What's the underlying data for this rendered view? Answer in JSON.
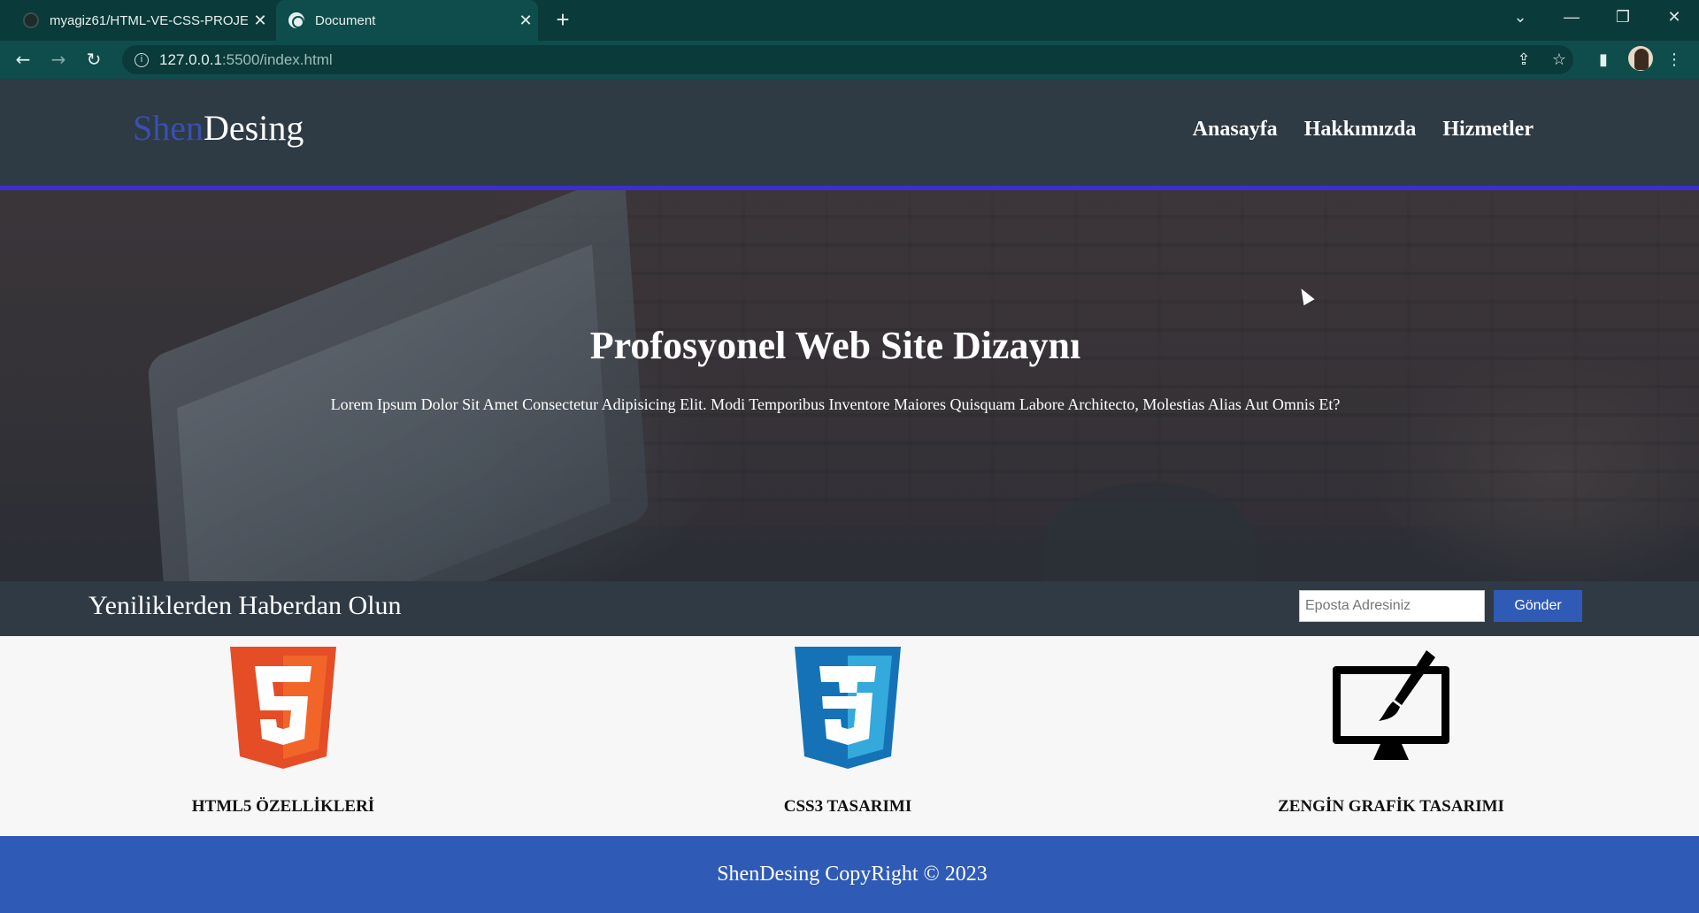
{
  "browser": {
    "tabs": [
      {
        "title": "myagiz61/HTML-VE-CSS-PROJE-",
        "close": "✕",
        "favicon": "github-icon"
      },
      {
        "title": "Document",
        "close": "✕",
        "favicon": "globe-icon"
      }
    ],
    "new_tab": "+",
    "window_controls": {
      "dropdown": "⌄",
      "minimize": "—",
      "restore": "❐",
      "close": "✕"
    },
    "nav": {
      "back": "←",
      "forward": "→",
      "reload": "↻"
    },
    "url": {
      "host": "127.0.0.1",
      "rest": ":5500/index.html",
      "info": "i"
    },
    "toolbar_icons": {
      "share": "⇪",
      "bookmark": "☆",
      "sidebar": "▮",
      "menu": "⋮"
    }
  },
  "site": {
    "logo": {
      "part1": "Shen",
      "part2": "Desing"
    },
    "menu": [
      "Anasayfa",
      "Hakkımızda",
      "Hizmetler"
    ],
    "hero": {
      "title": "Profosyonel Web Site Dizaynı",
      "text": "Lorem Ipsum Dolor Sit Amet Consectetur Adipisicing Elit. Modi Temporibus Inventore Maiores Quisquam Labore Architecto, Molestias Alias Aut Omnis Et?"
    },
    "newsletter": {
      "heading": "Yeniliklerden Haberdan Olun",
      "placeholder": "Eposta Adresiniz",
      "button": "Gönder"
    },
    "features": [
      {
        "label": "HTML5 ÖZELLİKLERİ",
        "icon": "html5-icon"
      },
      {
        "label": "CSS3 TASARIMI",
        "icon": "css3-icon"
      },
      {
        "label": "ZENGİN GRAFİK TASARIMI",
        "icon": "monitor-brush-icon"
      }
    ],
    "footer": "ShenDesing CopyRight © 2023"
  },
  "colors": {
    "browser_tabstrip": "#0a3a39",
    "browser_toolbar": "#0e4d4c",
    "header_bg": "#2e3a44",
    "header_border": "#3b2fd0",
    "logo_accent": "#3a4fb0",
    "button_bg": "#2f5bb7",
    "footer_bg": "#2f5bb7",
    "html5_orange": "#e44d26",
    "css3_blue": "#1572b6"
  }
}
